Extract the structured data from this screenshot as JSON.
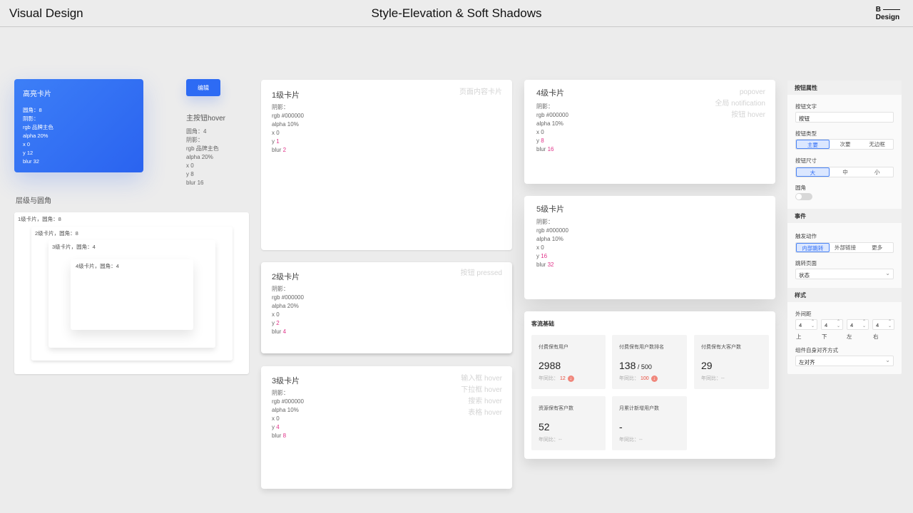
{
  "header": {
    "left_title": "Visual Design",
    "center_title": "Style-Elevation & Soft Shadows",
    "logo_top": "B",
    "logo_bottom": "Design"
  },
  "colors": {
    "brand": "#2d6bf4",
    "highlight": "#e0348a",
    "background": "#ececec"
  },
  "highlight_card": {
    "title": "高亮卡片",
    "lines": [
      "圆角：8",
      "阴影：",
      "rgb 品牌主色",
      "alpha 20%",
      "x 0",
      "y 12",
      "blur 32"
    ]
  },
  "primary_button": {
    "label": "编辑",
    "title": "主按钮hover",
    "lines": [
      "圆角：4",
      "阴影：",
      "rgb 品牌主色",
      "alpha 20%",
      "x 0",
      "y 8",
      "blur 16"
    ]
  },
  "nesting": {
    "title": "层级与圆角",
    "levels": [
      "1级卡片，圆角：8",
      "2级卡片，圆角：8",
      "3级卡片，圆角：4",
      "4级卡片，圆角：4"
    ]
  },
  "cards": [
    {
      "title": "1级卡片",
      "shadow_label": "阴影：",
      "rgb": "rgb #000000",
      "alpha": "alpha 10%",
      "x": "x 0",
      "y": "y ",
      "y_val": "1",
      "blur": "blur ",
      "blur_val": "2",
      "ghost": [
        "页面内容卡片"
      ]
    },
    {
      "title": "2级卡片",
      "shadow_label": "阴影：",
      "rgb": "rgb #000000",
      "alpha": "alpha 20%",
      "x": "x 0",
      "y": "y ",
      "y_val": "2",
      "blur": "blur ",
      "blur_val": "4",
      "ghost": [
        "按钮 pressed"
      ]
    },
    {
      "title": "3级卡片",
      "shadow_label": "阴影：",
      "rgb": "rgb #000000",
      "alpha": "alpha 10%",
      "x": "x 0",
      "y": "y ",
      "y_val": "4",
      "blur": "blur ",
      "blur_val": "8",
      "ghost": [
        "输入框 hover",
        "下拉框 hover",
        "搜索 hover",
        "表格 hover"
      ]
    },
    {
      "title": "4级卡片",
      "shadow_label": "阴影：",
      "rgb": "rgb #000000",
      "alpha": "alpha 10%",
      "x": "x 0",
      "y": "y ",
      "y_val": "8",
      "blur": "blur ",
      "blur_val": "16",
      "ghost": [
        "popover",
        "全局 notification",
        "按钮 hover"
      ]
    },
    {
      "title": "5级卡片",
      "shadow_label": "阴影：",
      "rgb": "rgb #000000",
      "alpha": "alpha 10%",
      "x": "x 0",
      "y": "y ",
      "y_val": "16",
      "blur": "blur ",
      "blur_val": "32",
      "ghost": []
    }
  ],
  "metrics": {
    "title": "客流基础",
    "items": [
      {
        "label": "付费保有用户",
        "value": "2988",
        "suffix": "",
        "yoy": "年同比：",
        "yoy_val": "12",
        "down": true
      },
      {
        "label": "付费保有用户数排名",
        "value": "138",
        "suffix": " / 500",
        "yoy": "年同比：",
        "yoy_val": "100",
        "down": true
      },
      {
        "label": "付费保有大客户数",
        "value": "29",
        "suffix": "",
        "yoy": "年同比：--",
        "yoy_val": "",
        "down": false
      },
      {
        "label": "资源保有客户数",
        "value": "52",
        "suffix": "",
        "yoy": "年同比：--",
        "yoy_val": "",
        "down": false
      },
      {
        "label": "月累计新增用户数",
        "value": "-",
        "suffix": "",
        "yoy": "年同比：--",
        "yoy_val": "",
        "down": false
      }
    ]
  },
  "panel": {
    "section1": "按钮属性",
    "text_label": "按钮文字",
    "text_value": "按钮",
    "type_label": "按钮类型",
    "type_options": [
      "主要",
      "次要",
      "无边框"
    ],
    "size_label": "按钮尺寸",
    "size_options": [
      "大",
      "中",
      "小"
    ],
    "radius_label": "圆角",
    "section2": "事件",
    "trigger_label": "触发动作",
    "trigger_options": [
      "内部跳转",
      "外部链接",
      "更多"
    ],
    "jump_label": "跳转页面",
    "jump_value": "状态",
    "section3": "样式",
    "margin_label": "外间距",
    "margins": [
      "4",
      "4",
      "4",
      "4"
    ],
    "margin_sides": [
      "上",
      "下",
      "左",
      "右"
    ],
    "align_label": "组件自身对齐方式",
    "align_value": "左对齐"
  }
}
